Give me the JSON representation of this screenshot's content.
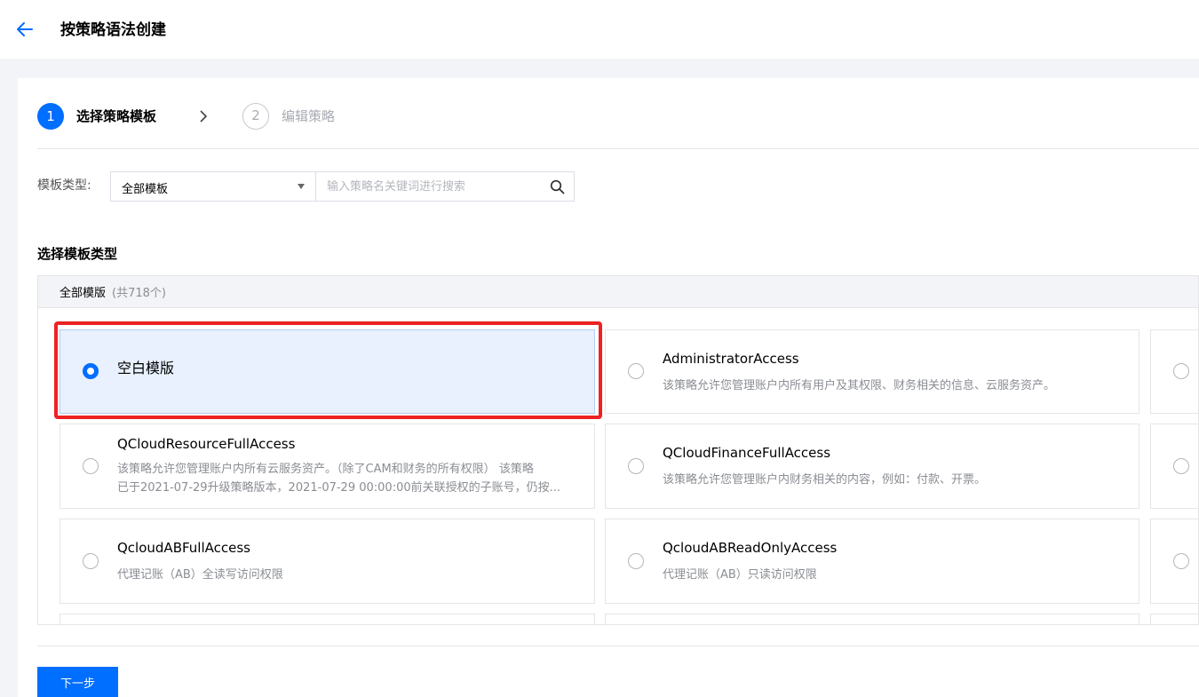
{
  "header": {
    "title": "按策略语法创建"
  },
  "steps": [
    {
      "number": "1",
      "label": "选择策略模板"
    },
    {
      "number": "2",
      "label": "编辑策略"
    }
  ],
  "filter": {
    "label": "模板类型:",
    "selected": "全部模板",
    "search_placeholder": "输入策略名关键词进行搜索"
  },
  "section_title": "选择模板类型",
  "list": {
    "header_name": "全部模版",
    "header_count": "(共718个)",
    "tiles": [
      {
        "name": "空白模版",
        "desc": "",
        "selected": true
      },
      {
        "name": "AdministratorAccess",
        "desc": "该策略允许您管理账户内所有用户及其权限、财务相关的信息、云服务资产。"
      },
      {
        "name": "QCloudResourceFullAccess",
        "desc": "该策略允许您管理账户内所有云服务资产。（除了CAM和财务的所有权限） 该策略",
        "desc2": "已于2021-07-29升级策略版本，2021-07-29 00:00:00前关联授权的子账号，仍按..."
      },
      {
        "name": "QCloudFinanceFullAccess",
        "desc": "该策略允许您管理账户内财务相关的内容，例如：付款、开票。"
      },
      {
        "name": "QcloudABFullAccess",
        "desc": "代理记账（AB）全读写访问权限"
      },
      {
        "name": "QcloudABReadOnlyAccess",
        "desc": "代理记账（AB）只读访问权限"
      }
    ]
  },
  "next_button": "下一步",
  "colors": {
    "primary": "#006eff",
    "highlight": "#ee2222",
    "selected_bg": "#e8f1fd"
  }
}
